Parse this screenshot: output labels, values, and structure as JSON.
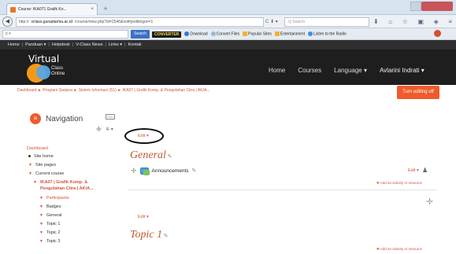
{
  "browser": {
    "tab_title": "Course: IKA071 Grafik Ko...",
    "tab_close": "×",
    "new_tab": "+",
    "url_prefix": "http://",
    "url_host": "vclass.gunadarma.ac.id",
    "url_path": "/course/view.php?id=2546&notifyeditingon=1",
    "url_icons": "C ⬇ ▾",
    "search_placeholder": "Q Search",
    "nav_icons": [
      "download-icon",
      "home-icon",
      "star-icon",
      "bookmarks-icon",
      "pocket-icon",
      "menu-icon"
    ],
    "nav_icon_glyphs": [
      "⬇",
      "⌂",
      "☆",
      "▣",
      "◈",
      "≡"
    ]
  },
  "toolbar": {
    "input_placeholder": "p ▾",
    "search_label": "Search",
    "converter_logo": "CONVERTER",
    "items": [
      "Download",
      "Convert Files",
      "Popular Sites",
      "Entertainment",
      "Listen to the Radio"
    ]
  },
  "site_menu": {
    "items": [
      "Home",
      "Panduan ▾",
      "Helpdesk",
      "V-Class News",
      "Links ▾",
      "Kontak"
    ],
    "separator": "|"
  },
  "hero": {
    "logo_word": "Virtual",
    "logo_sub1": "Class",
    "logo_sub2": "Online",
    "nav": [
      "Home",
      "Courses",
      "Language ▾",
      "Avlarini Indrati ▾"
    ]
  },
  "breadcrumb": "Dashboard ► Program Sarjana ► Sistem Informasi (S1) ► IKA07 | Grafik Komp. & Pengolahan Citra | AK/A...",
  "turn_editing_off": "Turn editing off",
  "navigation": {
    "title": "Navigation",
    "icon_letter": "≡",
    "block_ctl": "▭▭",
    "move": "✛",
    "gear": "✲ ▾",
    "items": [
      "Dashboard",
      "Site home",
      "Site pages",
      "Current course",
      "IKA07 | Grafik Komp. &",
      "Pengolahan Citra | AK/A...",
      "Participants",
      "Badges",
      "General",
      "Topic 1",
      "Topic 2",
      "Topic 3"
    ]
  },
  "content": {
    "edit_top": "Edit ▾",
    "general_title": "General",
    "pencil": "✎",
    "move_icon": "✛",
    "announcements": "Announcements",
    "edit_right": "Edit ▾",
    "person": "👤",
    "add_activity": "✚ Add an activity or resource",
    "add_section": "✛",
    "edit_mid": "Edit ▾",
    "topic1_title": "Topic 1",
    "add_activity2": "✚ Add an activity or resource"
  },
  "colors": {
    "accent": "#ef5b2d",
    "link": "#d0533a",
    "header_dark": "#1e1e1e"
  }
}
